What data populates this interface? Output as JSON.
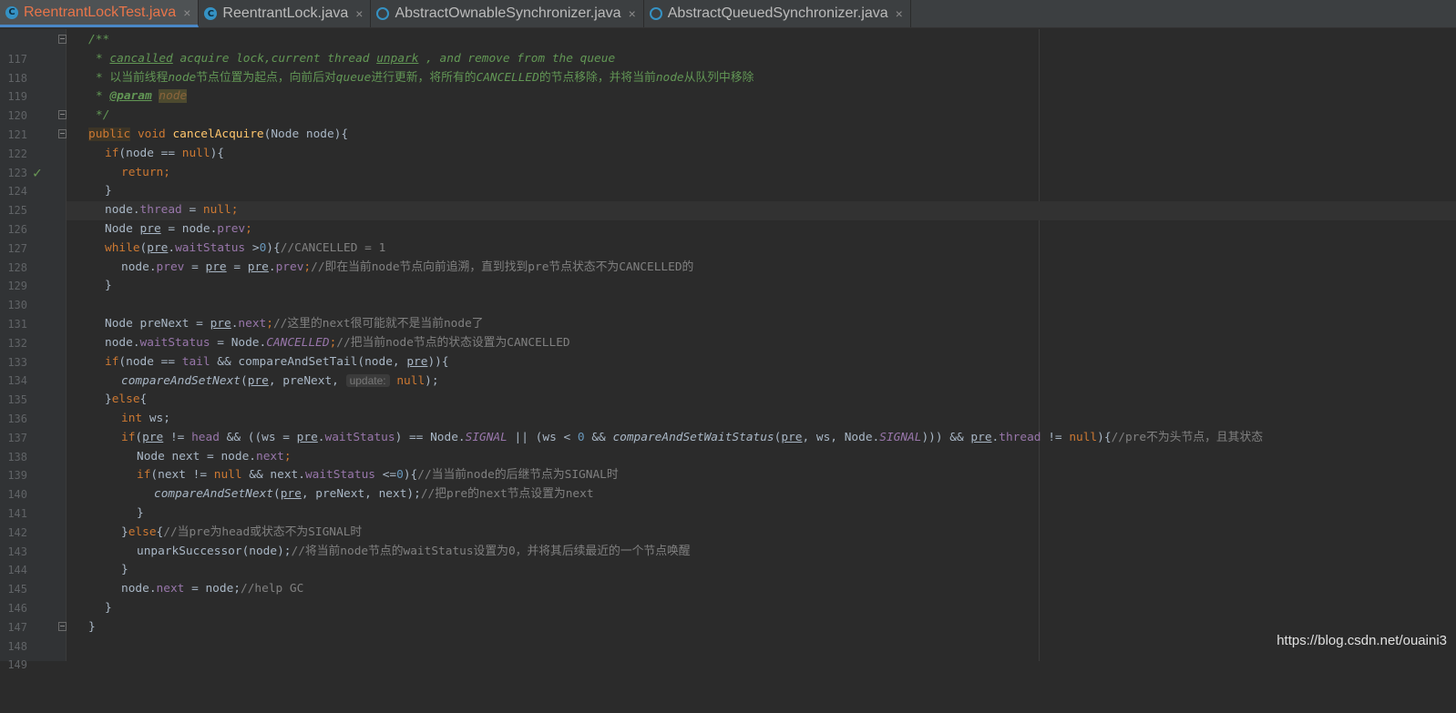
{
  "tabs": [
    {
      "label": "ReentrantLockTest.java",
      "icon": "class-icon",
      "active": true
    },
    {
      "label": "ReentrantLock.java",
      "icon": "class-icon",
      "active": false
    },
    {
      "label": "AbstractOwnableSynchronizer.java",
      "icon": "abstract-class-icon",
      "active": false
    },
    {
      "label": "AbstractQueuedSynchronizer.java",
      "icon": "abstract-class-icon",
      "active": false
    }
  ],
  "tab_close_glyph": "×",
  "line_numbers": [
    "117",
    "118",
    "119",
    "120",
    "121",
    "122",
    "123",
    "124",
    "125",
    "126",
    "127",
    "128",
    "129",
    "130",
    "131",
    "132",
    "133",
    "134",
    "135",
    "136",
    "137",
    "138",
    "139",
    "140",
    "141",
    "142",
    "143",
    "144",
    "145",
    "146",
    "147",
    "148",
    "149"
  ],
  "code": {
    "l117": "/**",
    "l118a": "* ",
    "l118b": "cancalled",
    "l118c": " acquire lock,current thread ",
    "l118d": "unpark",
    "l118e": " , and remove from the queue",
    "l119a": "* 以当前线程",
    "l119b": "node",
    "l119c": "节点位置为起点，向前后对",
    "l119d": "queue",
    "l119e": "进行更新，将所有的",
    "l119f": "CANCELLED",
    "l119g": "的节点移除，并将当前",
    "l119h": "node",
    "l119i": "从队列中移除",
    "l120a": "* ",
    "l120b": "@param",
    "l120c": " ",
    "l120d": "node",
    "l121": "*/",
    "l122a": "public",
    "l122b": " void ",
    "l122c": "cancelAcquire",
    "l122d": "(Node node){",
    "l123a": "if",
    "l123b": "(node == ",
    "l123c": "null",
    "l123d": "){",
    "l124a": "return",
    "l124b": ";",
    "l125": "}",
    "l126a": "node.",
    "l126b": "thread",
    "l126c": " = ",
    "l126d": "null",
    "l126e": ";",
    "l127a": "Node ",
    "l127b": "pre",
    "l127c": " = node.",
    "l127d": "prev",
    "l127e": ";",
    "l128a": "while",
    "l128b": "(",
    "l128c": "pre",
    "l128d": ".",
    "l128e": "waitStatus",
    "l128f": " >",
    "l128g": "0",
    "l128h": "){",
    "l128i": "//CANCELLED = 1",
    "l129a": "node.",
    "l129b": "prev",
    "l129c": " = ",
    "l129d": "pre",
    "l129e": " = ",
    "l129f": "pre",
    "l129g": ".",
    "l129h": "prev",
    "l129i": ";",
    "l129j": "//即在当前node节点向前追溯，直到找到pre节点状态不为CANCELLED的",
    "l130": "}",
    "l132a": "Node preNext = ",
    "l132b": "pre",
    "l132c": ".",
    "l132d": "next",
    "l132e": ";",
    "l132f": "//这里的next很可能就不是当前node了",
    "l133a": "node.",
    "l133b": "waitStatus",
    "l133c": " = Node.",
    "l133d": "CANCELLED",
    "l133e": ";",
    "l133f": "//把当前node节点的状态设置为CANCELLED",
    "l134a": "if",
    "l134b": "(node == ",
    "l134c": "tail",
    "l134d": " && compareAndSetTail(node, ",
    "l134e": "pre",
    "l134f": ")){",
    "l135a": "compareAndSetNext",
    "l135b": "(",
    "l135c": "pre",
    "l135d": ", preNext, ",
    "l135e": "update:",
    "l135f": " ",
    "l135g": "null",
    "l135h": ");",
    "l136a": "}",
    "l136b": "else",
    "l136c": "{",
    "l137a": "int",
    "l137b": " ws;",
    "l138a": "if",
    "l138b": "(",
    "l138c": "pre",
    "l138d": " != ",
    "l138e": "head",
    "l138f": " && ((ws = ",
    "l138g": "pre",
    "l138h": ".",
    "l138i": "waitStatus",
    "l138j": ") == Node.",
    "l138k": "SIGNAL",
    "l138l": " || (ws < ",
    "l138m": "0",
    "l138n": " && ",
    "l138o": "compareAndSetWaitStatus",
    "l138p": "(",
    "l138q": "pre",
    "l138r": ", ws, Node.",
    "l138s": "SIGNAL",
    "l138t": "))) && ",
    "l138u": "pre",
    "l138v": ".",
    "l138w": "thread",
    "l138x": " != ",
    "l138y": "null",
    "l138z": "){",
    "l138zz": "//pre不为头节点，且其状态",
    "l139a": "Node next = node.",
    "l139b": "next",
    "l139c": ";",
    "l140a": "if",
    "l140b": "(next != ",
    "l140c": "null",
    "l140d": " && next.",
    "l140e": "waitStatus",
    "l140f": " <=",
    "l140g": "0",
    "l140h": "){",
    "l140i": "//当当前node的后继节点为SIGNAL时",
    "l141a": "compareAndSetNext",
    "l141b": "(",
    "l141c": "pre",
    "l141d": ", preNext, next);",
    "l141e": "//把pre的next节点设置为next",
    "l142": "}",
    "l143a": "}",
    "l143b": "else",
    "l143c": "{",
    "l143d": "//当pre为head或状态不为SIGNAL时",
    "l144a": "unparkSuccessor(node);",
    "l144b": "//将当前node节点的waitStatus设置为0，并将其后续最近的一个节点唤醒",
    "l145": "}",
    "l146a": "node.",
    "l146b": "next",
    "l146c": " = node;",
    "l146d": "//help GC",
    "l147": "}",
    "l148": "}"
  },
  "gutter_marker": "✓",
  "watermark": "https://blog.csdn.net/ouaini3",
  "colors": {
    "keyword": "#cc7832",
    "comment": "#808080",
    "doc": "#629755",
    "field": "#9876aa",
    "number": "#6897bb",
    "method": "#ffc66d",
    "text": "#a9b7c6",
    "active_tab": "#e8754a"
  }
}
